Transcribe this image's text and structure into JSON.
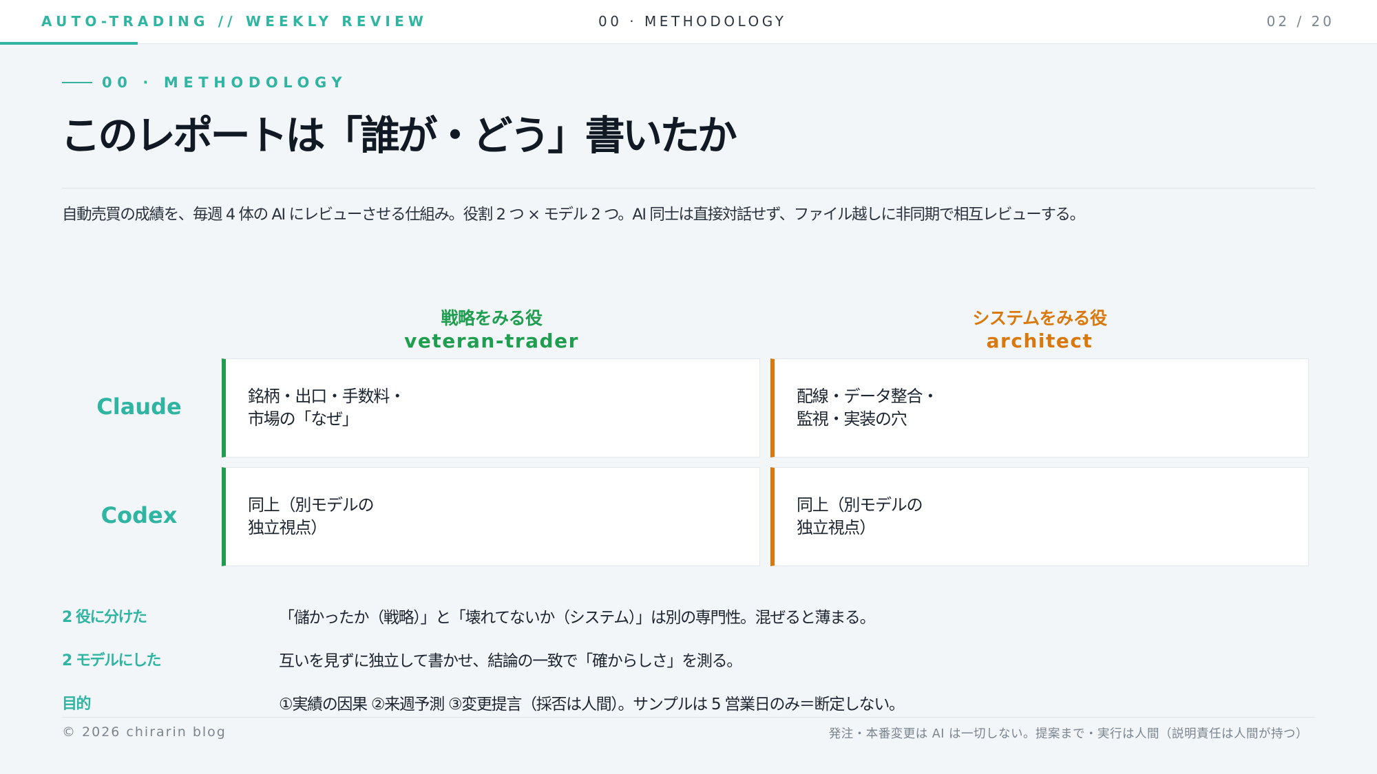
{
  "header": {
    "brand": "AUTO-TRADING // WEEKLY REVIEW",
    "section": "00 · METHODOLOGY",
    "pager": "02 / 20",
    "progress_fraction": 0.1
  },
  "eyebrow": "00 · METHODOLOGY",
  "title": "このレポートは「誰が・どう」書いたか",
  "lead": "自動売買の成績を、毎週 4 体の AI にレビューさせる仕組み。役割 2 つ × モデル 2 つ。AI 同士は直接対話せず、ファイル越しに非同期で相互レビューする。",
  "matrix": {
    "columns": [
      {
        "jp": "戦略をみる役",
        "en": "veteran-trader",
        "color": "#1f9e4f"
      },
      {
        "jp": "システムをみる役",
        "en": "architect",
        "color": "#d9790d"
      }
    ],
    "rows": [
      {
        "label": "Claude",
        "cells": [
          "銘柄・出口・手数料・\n市場の「なぜ」",
          "配線・データ整合・\n監視・実装の穴"
        ]
      },
      {
        "label": "Codex",
        "cells": [
          "同上（別モデルの\n独立視点）",
          "同上（別モデルの\n独立視点）"
        ]
      }
    ]
  },
  "notes": [
    {
      "label": "2 役に分けた",
      "text": "「儲かったか（戦略）」と「壊れてないか（システム）」は別の専門性。混ぜると薄まる。"
    },
    {
      "label": "2 モデルにした",
      "text": "互いを見ずに独立して書かせ、結論の一致で「確からしさ」を測る。"
    },
    {
      "label": "目的",
      "text": "①実績の因果 ②来週予測 ③変更提言（採否は人間）。サンプルは 5 営業日のみ＝断定しない。"
    }
  ],
  "footer": {
    "copyright": "© 2026 chirarin blog",
    "disclaimer": "発注・本番変更は AI は一切しない。提案まで・実行は人間（説明責任は人間が持つ）"
  }
}
